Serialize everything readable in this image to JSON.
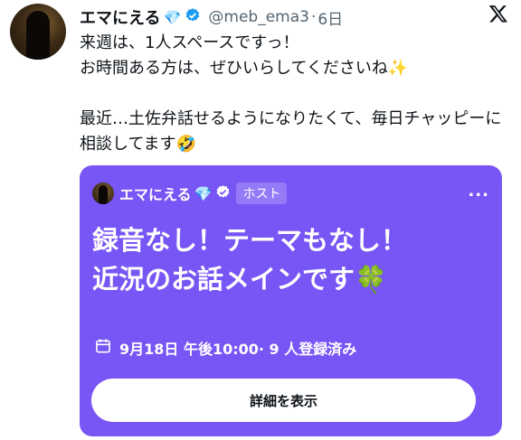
{
  "tweet": {
    "author_name": "エマにえる",
    "author_emoji": "💎",
    "handle": "@meb_ema3",
    "time": "6日",
    "handle_time_sep": "·",
    "body": "来週は、1人スペースですっ！\nお時間ある方は、ぜひいらしてくださいね✨\n\n最近…土佐弁話せるようになりたくて、毎日チャッピーに相談してます🤣"
  },
  "space_card": {
    "host_name": "エマにえる",
    "host_emoji": "💎",
    "host_badge": "ホスト",
    "more_label": "...",
    "title_line1": "録音なし！テーマもなし！",
    "title_line2": "近況のお話メインです🍀",
    "schedule": "9月18日 午後10:00· 9 人登録済み",
    "button_label": "詳細を表示"
  },
  "icons": {
    "verified": "verified-badge-icon",
    "x_logo": "x-logo-icon",
    "calendar": "calendar-icon",
    "more": "more-horizontal-icon"
  },
  "colors": {
    "card_bg": "#7855f5",
    "verified_blue": "#1d9bf0",
    "text": "#0f1419",
    "muted": "#536471"
  }
}
